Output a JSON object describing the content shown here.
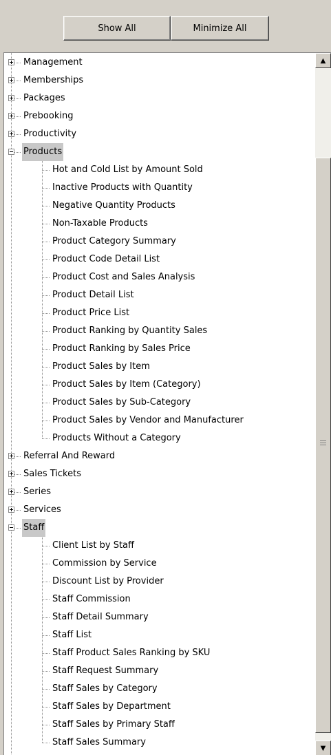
{
  "toolbar": {
    "show_all_label": "Show All",
    "minimize_all_label": "Minimize All"
  },
  "tree": {
    "nodes": [
      {
        "label": "Management",
        "level": 0,
        "expanded": false
      },
      {
        "label": "Memberships",
        "level": 0,
        "expanded": false
      },
      {
        "label": "Packages",
        "level": 0,
        "expanded": false
      },
      {
        "label": "Prebooking",
        "level": 0,
        "expanded": false
      },
      {
        "label": "Productivity",
        "level": 0,
        "expanded": false
      },
      {
        "label": "Products",
        "level": 0,
        "expanded": true,
        "selected": true
      },
      {
        "label": "Hot and Cold List by Amount Sold",
        "level": 1
      },
      {
        "label": "Inactive Products with Quantity",
        "level": 1
      },
      {
        "label": "Negative Quantity Products",
        "level": 1
      },
      {
        "label": "Non-Taxable Products",
        "level": 1
      },
      {
        "label": "Product Category Summary",
        "level": 1
      },
      {
        "label": "Product Code Detail List",
        "level": 1
      },
      {
        "label": "Product Cost and Sales Analysis",
        "level": 1
      },
      {
        "label": "Product Detail List",
        "level": 1
      },
      {
        "label": "Product Price List",
        "level": 1
      },
      {
        "label": "Product Ranking by Quantity Sales",
        "level": 1
      },
      {
        "label": "Product Ranking by Sales Price",
        "level": 1
      },
      {
        "label": "Product Sales by Item",
        "level": 1
      },
      {
        "label": "Product Sales by Item (Category)",
        "level": 1
      },
      {
        "label": "Product Sales by Sub-Category",
        "level": 1
      },
      {
        "label": "Product Sales by Vendor and Manufacturer",
        "level": 1
      },
      {
        "label": "Products Without a Category",
        "level": 1
      },
      {
        "label": "Referral And Reward",
        "level": 0,
        "expanded": false
      },
      {
        "label": "Sales Tickets",
        "level": 0,
        "expanded": false
      },
      {
        "label": "Series",
        "level": 0,
        "expanded": false
      },
      {
        "label": "Services",
        "level": 0,
        "expanded": false
      },
      {
        "label": "Staff",
        "level": 0,
        "expanded": true,
        "selected": true
      },
      {
        "label": "Client List by Staff",
        "level": 1
      },
      {
        "label": "Commission by Service",
        "level": 1
      },
      {
        "label": "Discount List by Provider",
        "level": 1
      },
      {
        "label": "Staff Commission",
        "level": 1
      },
      {
        "label": "Staff Detail Summary",
        "level": 1
      },
      {
        "label": "Staff List",
        "level": 1
      },
      {
        "label": "Staff Product Sales Ranking by SKU",
        "level": 1
      },
      {
        "label": "Staff Request Summary",
        "level": 1
      },
      {
        "label": "Staff Sales by Category",
        "level": 1
      },
      {
        "label": "Staff Sales by Department",
        "level": 1
      },
      {
        "label": "Staff Sales by Primary Staff",
        "level": 1
      },
      {
        "label": "Staff Sales Summary",
        "level": 1
      }
    ]
  },
  "scrollbar": {
    "up_icon": "▲",
    "down_icon": "▼"
  }
}
